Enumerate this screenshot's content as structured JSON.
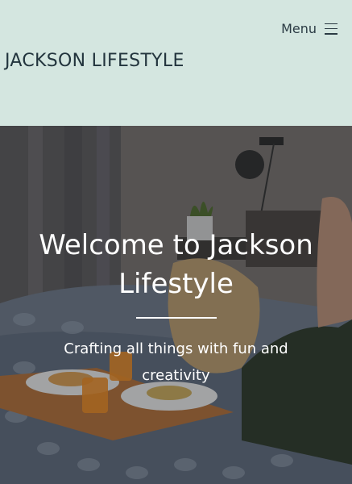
{
  "header": {
    "menu_label": "Menu",
    "menu_icon": "hamburger-icon",
    "site_title": "JACKSON LIFESTYLE"
  },
  "hero": {
    "title": "Welcome to Jackson Lifestyle",
    "subtitle": "Crafting all things with fun and creativity"
  },
  "colors": {
    "header_bg": "#d4e6e0",
    "header_text": "#22343d",
    "hero_text": "#ffffff"
  }
}
